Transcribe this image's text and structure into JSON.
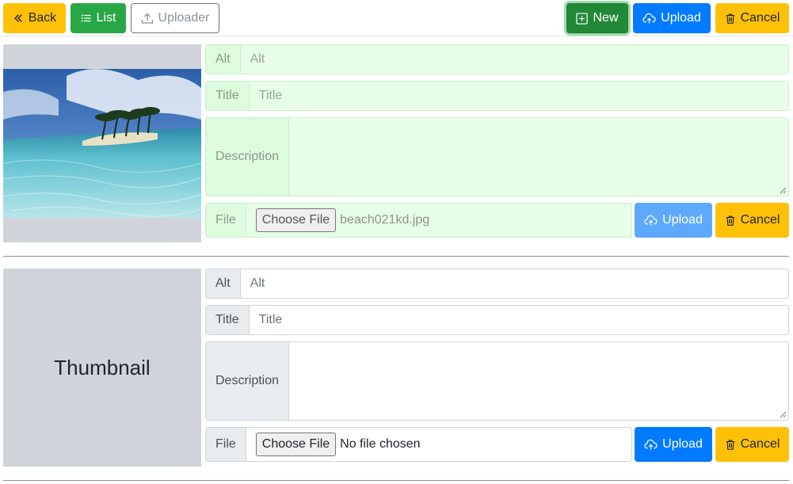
{
  "toolbar": {
    "back_label": "Back",
    "list_label": "List",
    "uploader_label": "Uploader",
    "new_label": "New",
    "upload_label": "Upload",
    "cancel_label": "Cancel"
  },
  "forms": [
    {
      "alt_label": "Alt",
      "alt_placeholder": "Alt",
      "title_label": "Title",
      "title_placeholder": "Title",
      "description_label": "Description",
      "file_label": "File",
      "choose_label": "Choose File",
      "file_name": "beach021kd.jpg",
      "upload_label": "Upload",
      "cancel_label": "Cancel",
      "has_image": true
    },
    {
      "thumbnail_text": "Thumbnail",
      "alt_label": "Alt",
      "alt_placeholder": "Alt",
      "title_label": "Title",
      "title_placeholder": "Title",
      "description_label": "Description",
      "file_label": "File",
      "choose_label": "Choose File",
      "file_name": "No file chosen",
      "upload_label": "Upload",
      "cancel_label": "Cancel",
      "has_image": false
    }
  ],
  "colors": {
    "warning": "#ffc107",
    "success": "#28a745",
    "primary": "#007bff",
    "filled_field": "#e6ffe6",
    "thumbnail_bg": "#d0d4da"
  },
  "icons": {
    "back": "double-chevron-left-icon",
    "list": "list-icon",
    "uploader": "upload-icon",
    "new": "plus-square-icon",
    "upload": "cloud-upload-icon",
    "cancel": "trash-icon"
  }
}
